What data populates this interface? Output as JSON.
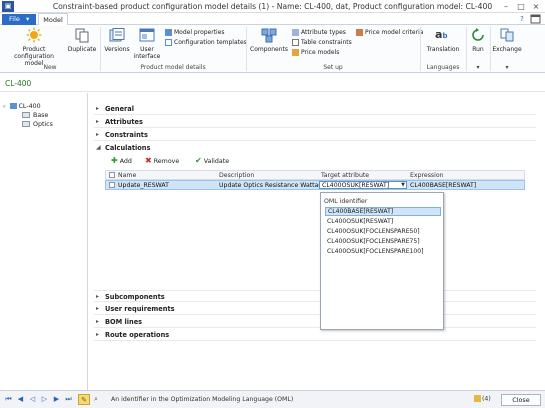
{
  "window": {
    "title": "Constraint-based product configuration model details (1) - Name: CL-400, dat, Product configuration model: CL-400",
    "controls": [
      "–",
      "□",
      "×"
    ]
  },
  "ribbon": {
    "file_tab": "File",
    "file_caret": "▾",
    "active_tab": "Model",
    "help_glyph": "?",
    "groups": {
      "new": {
        "label": "New",
        "product_configuration_model": "Product configuration model",
        "duplicate": "Duplicate"
      },
      "details": {
        "label": "Product model details",
        "versions": "Versions",
        "user_interface": "User interface",
        "model_properties": "Model properties",
        "configuration_templates": "Configuration templates"
      },
      "setup": {
        "label": "Set up",
        "components": "Components",
        "attribute_types": "Attribute types",
        "table_constraints": "Table constraints",
        "price_models": "Price models",
        "price_model_criteria": "Price model criteria"
      },
      "languages": {
        "label": "Languages",
        "translation": "Translation"
      },
      "run": {
        "label": "▾",
        "run": "Run"
      },
      "exchange": {
        "label": "▾",
        "exchange": "Exchange"
      }
    }
  },
  "record": {
    "title": "CL-400"
  },
  "tree": {
    "root": "CL-400",
    "children": [
      "Base",
      "Optics"
    ]
  },
  "fasttabs": {
    "general": "General",
    "attributes": "Attributes",
    "constraints": "Constraints",
    "calculations": "Calculations",
    "subcomponents": "Subcomponents",
    "user_requirements": "User requirements",
    "bom_lines": "BOM lines",
    "route_operations": "Route operations"
  },
  "calculations": {
    "toolbar": {
      "add": "Add",
      "remove": "Remove",
      "validate": "Validate"
    },
    "columns": [
      "Name",
      "Description",
      "Target attribute",
      "Expression"
    ],
    "rows": [
      {
        "name": "Update_RESWAT",
        "description": "Update Optics Resistance Wattage",
        "target_attribute": "CL400OSUK[RESWAT]",
        "expression": "CL400BASE[RESWAT]"
      }
    ]
  },
  "lookup": {
    "header": "OML identifier",
    "items": [
      "CL400BASE[RESWAT]",
      "CL400OSUK[RESWAT]",
      "CL400OSUK[FOCLENSPARE50]",
      "CL400OSUK[FOCLENSPARE75]",
      "CL400OSUK[FOCLENSPARE100]"
    ],
    "selected_index": 0
  },
  "statusbar": {
    "help_text": "An identifier in the Optimization Modeling Language (OML)",
    "notifications": "(4)",
    "close": "Close"
  },
  "colors": {
    "accent_blue": "#2b6cc4",
    "record_green": "#1f7a1f",
    "selection": "#cfe4f7"
  }
}
